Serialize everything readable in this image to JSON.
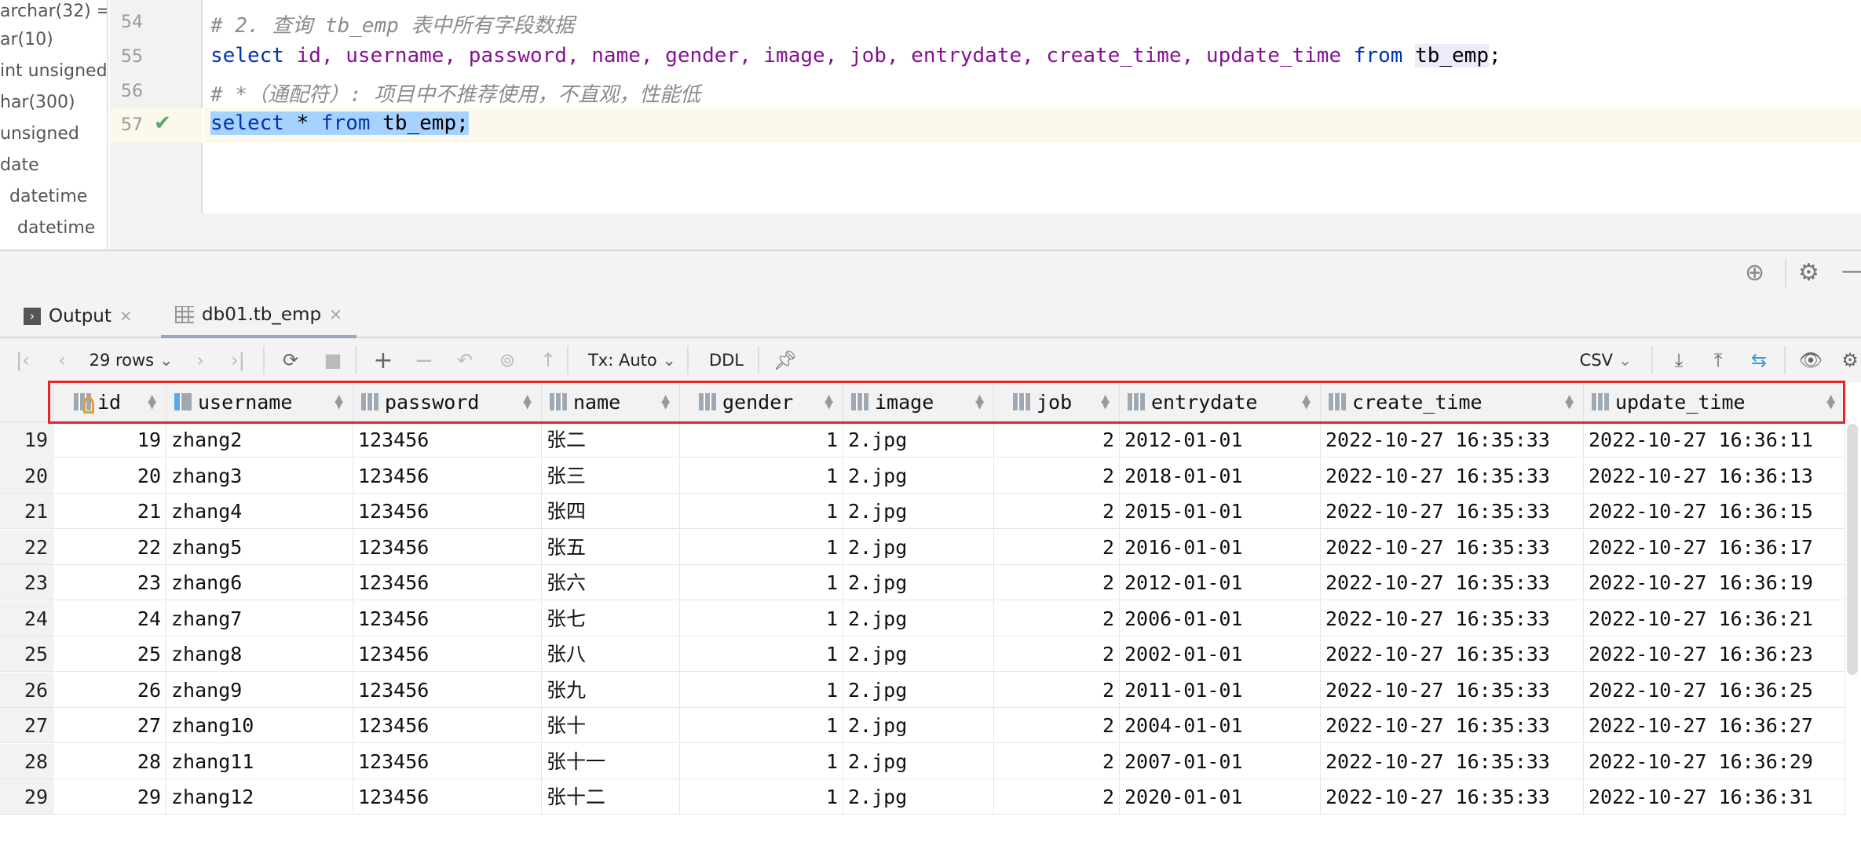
{
  "sidebar": {
    "items": [
      "archar(32) = '",
      "ar(10)",
      "int unsigned",
      "har(300)",
      "unsigned",
      "date",
      "datetime",
      "datetime"
    ]
  },
  "editor": {
    "lines": [
      {
        "num": "54",
        "text": "# 2. 查询 tb_emp 表中所有字段数据"
      },
      {
        "num": "55",
        "select": "select",
        "cols": "id, username, password, name, gender, image, job, entrydate, create_time, update_time",
        "from": "from",
        "table": "tb_emp",
        "semi": ";"
      },
      {
        "num": "56",
        "text": "# *（通配符）: 项目中不推荐使用，不直观，性能低"
      },
      {
        "num": "57",
        "select": "select",
        "star": "*",
        "from": "from",
        "table": "tb_emp",
        "semi": ";",
        "status": "check-icon"
      }
    ]
  },
  "tabs": [
    {
      "label": "Output",
      "icon": "console-icon"
    },
    {
      "label": "db01.tb_emp",
      "icon": "table-icon",
      "active": true
    }
  ],
  "toolbar": {
    "rows": "29 rows",
    "tx": "Tx: Auto",
    "ddl": "DDL",
    "export": "CSV"
  },
  "table": {
    "columns": [
      "id",
      "username",
      "password",
      "name",
      "gender",
      "image",
      "job",
      "entrydate",
      "create_time",
      "update_time"
    ],
    "rows": [
      [
        "19",
        "19",
        "zhang2",
        "123456",
        "张二",
        "1",
        "2.jpg",
        "2",
        "2012-01-01",
        "2022-10-27 16:35:33",
        "2022-10-27 16:36:11"
      ],
      [
        "20",
        "20",
        "zhang3",
        "123456",
        "张三",
        "1",
        "2.jpg",
        "2",
        "2018-01-01",
        "2022-10-27 16:35:33",
        "2022-10-27 16:36:13"
      ],
      [
        "21",
        "21",
        "zhang4",
        "123456",
        "张四",
        "1",
        "2.jpg",
        "2",
        "2015-01-01",
        "2022-10-27 16:35:33",
        "2022-10-27 16:36:15"
      ],
      [
        "22",
        "22",
        "zhang5",
        "123456",
        "张五",
        "1",
        "2.jpg",
        "2",
        "2016-01-01",
        "2022-10-27 16:35:33",
        "2022-10-27 16:36:17"
      ],
      [
        "23",
        "23",
        "zhang6",
        "123456",
        "张六",
        "1",
        "2.jpg",
        "2",
        "2012-01-01",
        "2022-10-27 16:35:33",
        "2022-10-27 16:36:19"
      ],
      [
        "24",
        "24",
        "zhang7",
        "123456",
        "张七",
        "1",
        "2.jpg",
        "2",
        "2006-01-01",
        "2022-10-27 16:35:33",
        "2022-10-27 16:36:21"
      ],
      [
        "25",
        "25",
        "zhang8",
        "123456",
        "张八",
        "1",
        "2.jpg",
        "2",
        "2002-01-01",
        "2022-10-27 16:35:33",
        "2022-10-27 16:36:23"
      ],
      [
        "26",
        "26",
        "zhang9",
        "123456",
        "张九",
        "1",
        "2.jpg",
        "2",
        "2011-01-01",
        "2022-10-27 16:35:33",
        "2022-10-27 16:36:25"
      ],
      [
        "27",
        "27",
        "zhang10",
        "123456",
        "张十",
        "1",
        "2.jpg",
        "2",
        "2004-01-01",
        "2022-10-27 16:35:33",
        "2022-10-27 16:36:27"
      ],
      [
        "28",
        "28",
        "zhang11",
        "123456",
        "张十一",
        "1",
        "2.jpg",
        "2",
        "2007-01-01",
        "2022-10-27 16:35:33",
        "2022-10-27 16:36:29"
      ],
      [
        "29",
        "29",
        "zhang12",
        "123456",
        "张十二",
        "1",
        "2.jpg",
        "2",
        "2020-01-01",
        "2022-10-27 16:35:33",
        "2022-10-27 16:36:31"
      ]
    ]
  },
  "colors": {
    "highlight_box": "#e8232b",
    "keyword": "#0033b3",
    "column": "#871094",
    "selection": "#a6d2ff"
  }
}
